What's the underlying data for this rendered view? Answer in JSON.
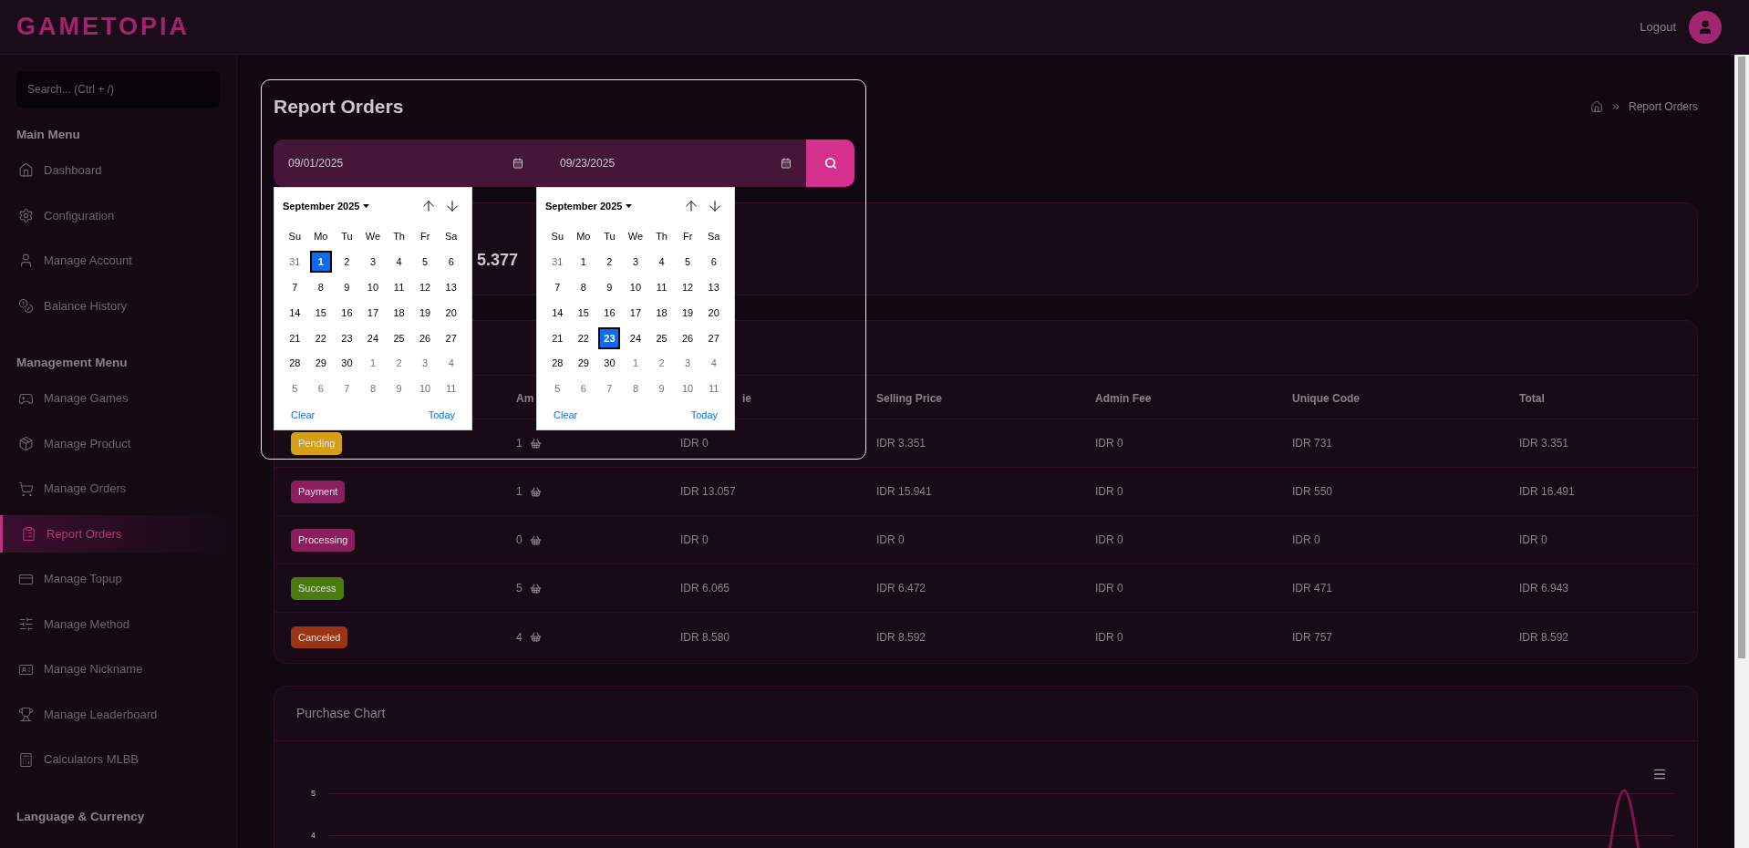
{
  "header": {
    "logo": "GAMETOPIA",
    "logout": "Logout"
  },
  "sidebar": {
    "search": {
      "placeholder": "Search... (Ctrl + /)"
    },
    "sections": [
      {
        "title": "Main Menu",
        "items": [
          {
            "label": "Dashboard",
            "selected": false
          },
          {
            "label": "Configuration",
            "selected": false
          },
          {
            "label": "Manage Account",
            "selected": false
          },
          {
            "label": "Balance History",
            "selected": false
          }
        ]
      },
      {
        "title": "Management Menu",
        "items": [
          {
            "label": "Manage Games",
            "selected": false
          },
          {
            "label": "Manage Product",
            "selected": false
          },
          {
            "label": "Manage Orders",
            "selected": false
          },
          {
            "label": "Report Orders",
            "selected": true
          },
          {
            "label": "Manage Topup",
            "selected": false
          },
          {
            "label": "Manage Method",
            "selected": false
          },
          {
            "label": "Manage Nickname",
            "selected": false
          },
          {
            "label": "Manage Leaderboard",
            "selected": false
          },
          {
            "label": "Calculators MLBB",
            "selected": false
          }
        ]
      },
      {
        "title": "Language & Currency"
      }
    ]
  },
  "page": {
    "title": "Report Orders",
    "breadcrumb": "Report Orders"
  },
  "date_range": {
    "from": "09/01/2025",
    "to": "09/23/2025"
  },
  "calendars": [
    {
      "month": "September 2025",
      "weekdays": [
        "Su",
        "Mo",
        "Tu",
        "We",
        "Th",
        "Fr",
        "Sa"
      ],
      "clear": "Clear",
      "today": "Today",
      "weeks": [
        [
          {
            "d": "31",
            "muted": true,
            "selected": false
          },
          {
            "d": "1",
            "muted": false,
            "selected": true
          },
          {
            "d": "2",
            "muted": false,
            "selected": false
          },
          {
            "d": "3",
            "muted": false,
            "selected": false
          },
          {
            "d": "4",
            "muted": false,
            "selected": false
          },
          {
            "d": "5",
            "muted": false,
            "selected": false
          },
          {
            "d": "6",
            "muted": false,
            "selected": false
          }
        ],
        [
          {
            "d": "7",
            "muted": false,
            "selected": false
          },
          {
            "d": "8",
            "muted": false,
            "selected": false
          },
          {
            "d": "9",
            "muted": false,
            "selected": false
          },
          {
            "d": "10",
            "muted": false,
            "selected": false
          },
          {
            "d": "11",
            "muted": false,
            "selected": false
          },
          {
            "d": "12",
            "muted": false,
            "selected": false
          },
          {
            "d": "13",
            "muted": false,
            "selected": false
          }
        ],
        [
          {
            "d": "14",
            "muted": false,
            "selected": false
          },
          {
            "d": "15",
            "muted": false,
            "selected": false
          },
          {
            "d": "16",
            "muted": false,
            "selected": false
          },
          {
            "d": "17",
            "muted": false,
            "selected": false
          },
          {
            "d": "18",
            "muted": false,
            "selected": false
          },
          {
            "d": "19",
            "muted": false,
            "selected": false
          },
          {
            "d": "20",
            "muted": false,
            "selected": false
          }
        ],
        [
          {
            "d": "21",
            "muted": false,
            "selected": false
          },
          {
            "d": "22",
            "muted": false,
            "selected": false
          },
          {
            "d": "23",
            "muted": false,
            "selected": false
          },
          {
            "d": "24",
            "muted": false,
            "selected": false
          },
          {
            "d": "25",
            "muted": false,
            "selected": false
          },
          {
            "d": "26",
            "muted": false,
            "selected": false
          },
          {
            "d": "27",
            "muted": false,
            "selected": false
          }
        ],
        [
          {
            "d": "28",
            "muted": false,
            "selected": false
          },
          {
            "d": "29",
            "muted": false,
            "selected": false
          },
          {
            "d": "30",
            "muted": false,
            "selected": false
          },
          {
            "d": "1",
            "muted": true,
            "selected": false
          },
          {
            "d": "2",
            "muted": true,
            "selected": false
          },
          {
            "d": "3",
            "muted": true,
            "selected": false
          },
          {
            "d": "4",
            "muted": true,
            "selected": false
          }
        ],
        [
          {
            "d": "5",
            "muted": true,
            "selected": false
          },
          {
            "d": "6",
            "muted": true,
            "selected": false
          },
          {
            "d": "7",
            "muted": true,
            "selected": false
          },
          {
            "d": "8",
            "muted": true,
            "selected": false
          },
          {
            "d": "9",
            "muted": true,
            "selected": false
          },
          {
            "d": "10",
            "muted": true,
            "selected": false
          },
          {
            "d": "11",
            "muted": true,
            "selected": false
          }
        ]
      ]
    },
    {
      "month": "September 2025",
      "weekdays": [
        "Su",
        "Mo",
        "Tu",
        "We",
        "Th",
        "Fr",
        "Sa"
      ],
      "clear": "Clear",
      "today": "Today",
      "weeks": [
        [
          {
            "d": "31",
            "muted": true,
            "selected": false
          },
          {
            "d": "1",
            "muted": false,
            "selected": false
          },
          {
            "d": "2",
            "muted": false,
            "selected": false
          },
          {
            "d": "3",
            "muted": false,
            "selected": false
          },
          {
            "d": "4",
            "muted": false,
            "selected": false
          },
          {
            "d": "5",
            "muted": false,
            "selected": false
          },
          {
            "d": "6",
            "muted": false,
            "selected": false
          }
        ],
        [
          {
            "d": "7",
            "muted": false,
            "selected": false
          },
          {
            "d": "8",
            "muted": false,
            "selected": false
          },
          {
            "d": "9",
            "muted": false,
            "selected": false
          },
          {
            "d": "10",
            "muted": false,
            "selected": false
          },
          {
            "d": "11",
            "muted": false,
            "selected": false
          },
          {
            "d": "12",
            "muted": false,
            "selected": false
          },
          {
            "d": "13",
            "muted": false,
            "selected": false
          }
        ],
        [
          {
            "d": "14",
            "muted": false,
            "selected": false
          },
          {
            "d": "15",
            "muted": false,
            "selected": false
          },
          {
            "d": "16",
            "muted": false,
            "selected": false
          },
          {
            "d": "17",
            "muted": false,
            "selected": false
          },
          {
            "d": "18",
            "muted": false,
            "selected": false
          },
          {
            "d": "19",
            "muted": false,
            "selected": false
          },
          {
            "d": "20",
            "muted": false,
            "selected": false
          }
        ],
        [
          {
            "d": "21",
            "muted": false,
            "selected": false
          },
          {
            "d": "22",
            "muted": false,
            "selected": false
          },
          {
            "d": "23",
            "muted": false,
            "selected": true
          },
          {
            "d": "24",
            "muted": false,
            "selected": false
          },
          {
            "d": "25",
            "muted": false,
            "selected": false
          },
          {
            "d": "26",
            "muted": false,
            "selected": false
          },
          {
            "d": "27",
            "muted": false,
            "selected": false
          }
        ],
        [
          {
            "d": "28",
            "muted": false,
            "selected": false
          },
          {
            "d": "29",
            "muted": false,
            "selected": false
          },
          {
            "d": "30",
            "muted": false,
            "selected": false
          },
          {
            "d": "1",
            "muted": true,
            "selected": false
          },
          {
            "d": "2",
            "muted": true,
            "selected": false
          },
          {
            "d": "3",
            "muted": true,
            "selected": false
          },
          {
            "d": "4",
            "muted": true,
            "selected": false
          }
        ],
        [
          {
            "d": "5",
            "muted": true,
            "selected": false
          },
          {
            "d": "6",
            "muted": true,
            "selected": false
          },
          {
            "d": "7",
            "muted": true,
            "selected": false
          },
          {
            "d": "8",
            "muted": true,
            "selected": false
          },
          {
            "d": "9",
            "muted": true,
            "selected": false
          },
          {
            "d": "10",
            "muted": true,
            "selected": false
          },
          {
            "d": "11",
            "muted": true,
            "selected": false
          }
        ]
      ]
    }
  ],
  "summary": {
    "value": "5.377"
  },
  "table": {
    "columns": [
      "Am",
      "ie",
      "Selling Price",
      "Admin Fee",
      "Unique Code",
      "Total"
    ],
    "rows": [
      {
        "status": "Pending",
        "color": "#d4a017",
        "amount": "1",
        "purchase": "IDR 0",
        "selling": "IDR 3.351",
        "admin": "IDR 0",
        "unique": "IDR 731",
        "total": "IDR 3.351"
      },
      {
        "status": "Payment",
        "color": "#8b1e5c",
        "amount": "1",
        "purchase": "IDR 13.057",
        "selling": "IDR 15.941",
        "admin": "IDR 0",
        "unique": "IDR 550",
        "total": "IDR 16.491"
      },
      {
        "status": "Processing",
        "color": "#8b1e5c",
        "amount": "0",
        "purchase": "IDR 0",
        "selling": "IDR 0",
        "admin": "IDR 0",
        "unique": "IDR 0",
        "total": "IDR 0"
      },
      {
        "status": "Success",
        "color": "#4a7a10",
        "amount": "5",
        "purchase": "IDR 6.065",
        "selling": "IDR 6.472",
        "admin": "IDR 0",
        "unique": "IDR 471",
        "total": "IDR 6.943"
      },
      {
        "status": "Canceled",
        "color": "#9a3412",
        "amount": "4",
        "purchase": "IDR 8.580",
        "selling": "IDR 8.592",
        "admin": "IDR 0",
        "unique": "IDR 757",
        "total": "IDR 8.592"
      }
    ]
  },
  "chart": {
    "title": "Purchase Chart",
    "y_ticks": [
      "5",
      "4"
    ]
  }
}
